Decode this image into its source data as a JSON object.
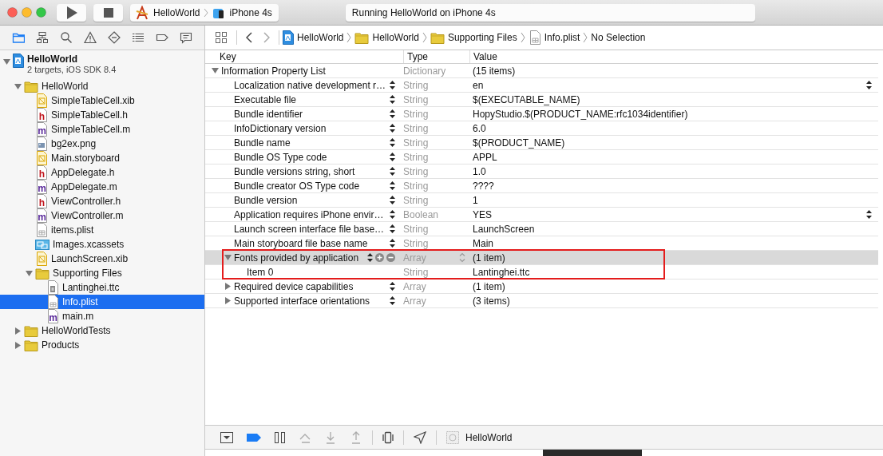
{
  "toolbar": {
    "scheme": {
      "project": "HelloWorld",
      "device": "iPhone 4s"
    },
    "status": "Running HelloWorld on iPhone 4s"
  },
  "navigator": {
    "tabs": [
      {
        "kind": "folder",
        "selected": true
      },
      {
        "kind": "hierarchy",
        "selected": false
      },
      {
        "kind": "search",
        "selected": false
      },
      {
        "kind": "warning",
        "selected": false
      },
      {
        "kind": "test",
        "selected": false
      },
      {
        "kind": "list",
        "selected": false
      },
      {
        "kind": "tag",
        "selected": false
      },
      {
        "kind": "chat",
        "selected": false
      }
    ],
    "tree": [
      {
        "name": "HelloWorld",
        "subtitle": "2 targets, iOS SDK 8.4",
        "kind": "project",
        "expanded": true,
        "selected": false,
        "children": [
          {
            "name": "HelloWorld",
            "kind": "folder",
            "expanded": true,
            "selected": false,
            "children": [
              {
                "name": "SimpleTableCell.xib",
                "kind": "xib",
                "selected": false
              },
              {
                "name": "SimpleTableCell.h",
                "kind": "source",
                "badge": "h",
                "selected": false
              },
              {
                "name": "SimpleTableCell.m",
                "kind": "source",
                "badge": "m",
                "selected": false
              },
              {
                "name": "bg2ex.png",
                "kind": "image",
                "selected": false
              },
              {
                "name": "Main.storyboard",
                "kind": "xib",
                "selected": false
              },
              {
                "name": "AppDelegate.h",
                "kind": "source",
                "badge": "h",
                "selected": false
              },
              {
                "name": "AppDelegate.m",
                "kind": "source",
                "badge": "m",
                "selected": false
              },
              {
                "name": "ViewController.h",
                "kind": "source",
                "badge": "h",
                "selected": false
              },
              {
                "name": "ViewController.m",
                "kind": "source",
                "badge": "m",
                "selected": false
              },
              {
                "name": "items.plist",
                "kind": "plist",
                "selected": false
              },
              {
                "name": "Images.xcassets",
                "kind": "assets",
                "selected": false
              },
              {
                "name": "LaunchScreen.xib",
                "kind": "xib",
                "selected": false
              },
              {
                "name": "Supporting Files",
                "kind": "folder",
                "expanded": true,
                "selected": false,
                "children": [
                  {
                    "name": "Lantinghei.ttc",
                    "kind": "font",
                    "selected": false
                  },
                  {
                    "name": "Info.plist",
                    "kind": "plist",
                    "selected": true
                  },
                  {
                    "name": "main.m",
                    "kind": "source",
                    "badge": "m",
                    "selected": false
                  }
                ]
              }
            ]
          },
          {
            "name": "HelloWorldTests",
            "kind": "folder",
            "expanded": false,
            "selected": false
          },
          {
            "name": "Products",
            "kind": "folder",
            "expanded": false,
            "selected": false
          }
        ]
      }
    ]
  },
  "jump_bar": {
    "path": [
      {
        "label": "HelloWorld",
        "kind": "project"
      },
      {
        "label": "HelloWorld",
        "kind": "folder"
      },
      {
        "label": "Supporting Files",
        "kind": "folder"
      },
      {
        "label": "Info.plist",
        "kind": "plist"
      },
      {
        "label": "No Selection",
        "kind": "none"
      }
    ]
  },
  "plist": {
    "columns": [
      "Key",
      "Type",
      "Value"
    ],
    "rows": [
      {
        "key": "Information Property List",
        "type": "Dictionary",
        "value": "(15 items)",
        "expanded": true,
        "selected": false,
        "children": [
          {
            "key": "Localization native development r…",
            "type": "String",
            "value": "en",
            "value_popup": true,
            "selected": false
          },
          {
            "key": "Executable file",
            "type": "String",
            "value": "$(EXECUTABLE_NAME)",
            "selected": false
          },
          {
            "key": "Bundle identifier",
            "type": "String",
            "value": "HopyStudio.$(PRODUCT_NAME:rfc1034identifier)",
            "selected": false
          },
          {
            "key": "InfoDictionary version",
            "type": "String",
            "value": "6.0",
            "selected": false
          },
          {
            "key": "Bundle name",
            "type": "String",
            "value": "$(PRODUCT_NAME)",
            "selected": false
          },
          {
            "key": "Bundle OS Type code",
            "type": "String",
            "value": "APPL",
            "selected": false
          },
          {
            "key": "Bundle versions string, short",
            "type": "String",
            "value": "1.0",
            "selected": false
          },
          {
            "key": "Bundle creator OS Type code",
            "type": "String",
            "value": "????",
            "selected": false
          },
          {
            "key": "Bundle version",
            "type": "String",
            "value": "1",
            "selected": false
          },
          {
            "key": "Application requires iPhone envir…",
            "type": "Boolean",
            "value": "YES",
            "value_popup": true,
            "selected": false
          },
          {
            "key": "Launch screen interface file base…",
            "type": "String",
            "value": "LaunchScreen",
            "selected": false
          },
          {
            "key": "Main storyboard file base name",
            "type": "String",
            "value": "Main",
            "selected": false
          },
          {
            "key": "Fonts provided by application",
            "type": "Array",
            "value": "(1 item)",
            "expanded": true,
            "selected": true,
            "annotated": true,
            "children": [
              {
                "key": "Item 0",
                "type": "String",
                "value": "Lantinghei.ttc",
                "selected": false
              }
            ]
          },
          {
            "key": "Required device capabilities",
            "type": "Array",
            "value": "(1 item)",
            "expanded": false,
            "selected": false
          },
          {
            "key": "Supported interface orientations",
            "type": "Array",
            "value": "(3 items)",
            "expanded": false,
            "selected": false
          }
        ]
      }
    ]
  },
  "debug_bar": {
    "buttons": [
      {
        "kind": "toggle",
        "disabled": false
      },
      {
        "kind": "breakpoints",
        "disabled": false
      },
      {
        "kind": "pause",
        "disabled": false
      },
      {
        "kind": "step-over",
        "disabled": true
      },
      {
        "kind": "step-into",
        "disabled": true
      },
      {
        "kind": "step-out",
        "disabled": true
      },
      {
        "kind": "view-debug",
        "disabled": false
      },
      {
        "kind": "location",
        "disabled": false
      }
    ],
    "target": "HelloWorld"
  }
}
